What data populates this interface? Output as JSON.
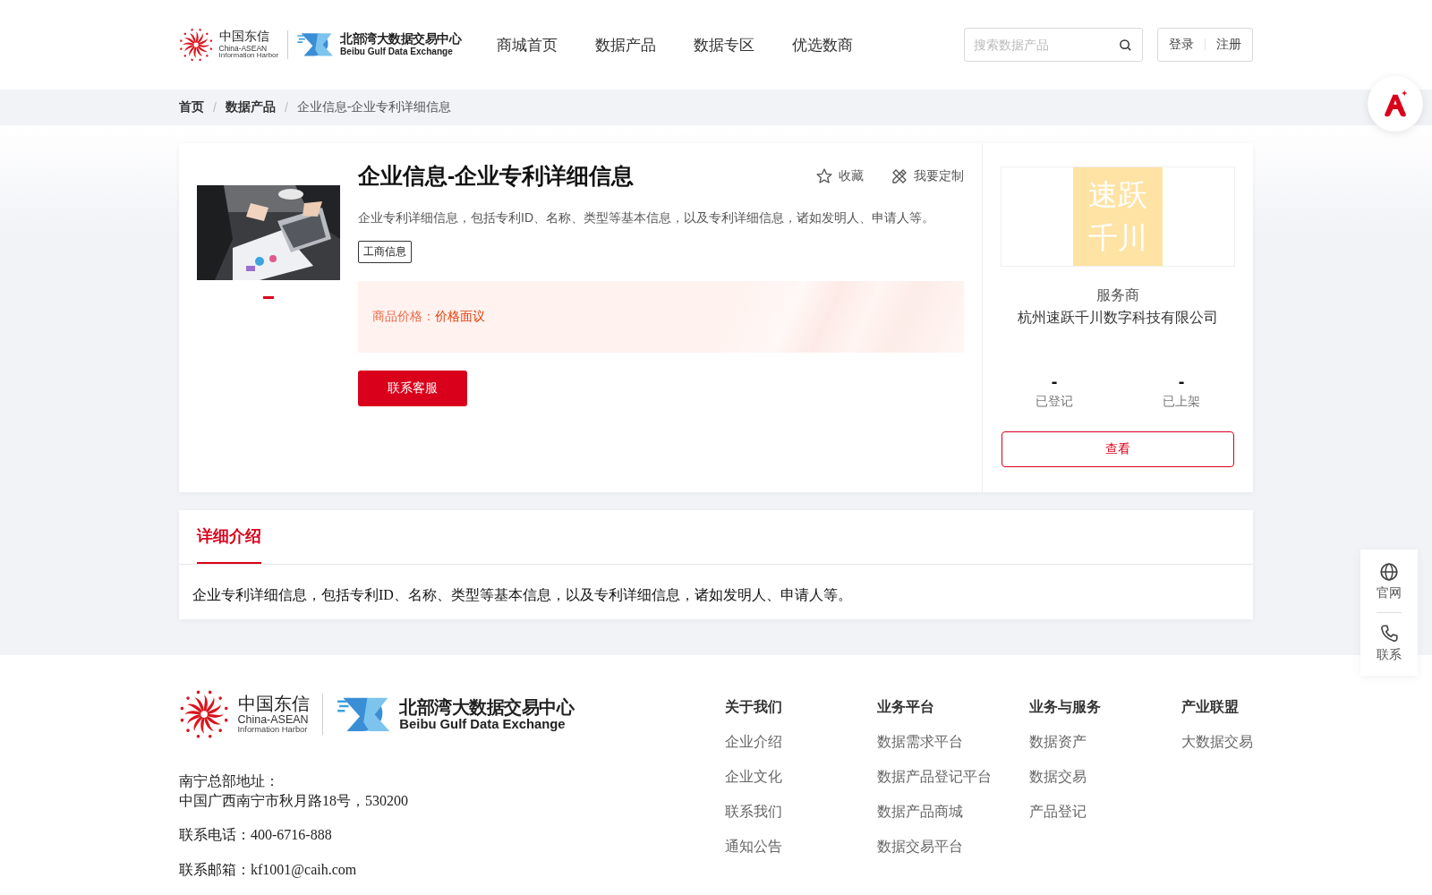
{
  "logo": {
    "cn": "中国东信",
    "en1": "China-ASEAN",
    "en2": "Information Harbor",
    "exchange_cn": "北部湾大数据交易中心",
    "exchange_en": "Beibu Gulf Data Exchange"
  },
  "nav": [
    {
      "label": "商城首页",
      "selected": false
    },
    {
      "label": "数据产品",
      "selected": false
    },
    {
      "label": "数据专区",
      "selected": false
    },
    {
      "label": "优选数商",
      "selected": false
    }
  ],
  "search": {
    "placeholder": "搜索数据产品"
  },
  "auth": [
    "登录",
    "注册"
  ],
  "breadcrumb": [
    "首页",
    "数据产品",
    "企业信息-企业专利详细信息"
  ],
  "breadcrumb_separator": "/",
  "product": {
    "title": "企业信息-企业专利详细信息",
    "actions": [
      "收藏",
      "我要定制"
    ],
    "description": "企业专利详细信息，包括专利ID、名称、类型等基本信息，以及专利详细信息，诸如发明人、申请人等。",
    "tags": [
      "工商信息"
    ],
    "price_label": "商品价格：",
    "price": "价格面议",
    "button": "联系客服",
    "slides": [
      {
        "kind": "picture",
        "selected": true
      }
    ]
  },
  "provider": {
    "logo_lines": [
      "速跃",
      "千川"
    ],
    "role": "服务商",
    "name": "杭州速跃千川数字科技有限公司",
    "stats": [
      {
        "value": "-",
        "label": "已登记"
      },
      {
        "value": "-",
        "label": "已上架"
      }
    ],
    "button": "查看"
  },
  "detail": {
    "tabs": [
      {
        "label": "详细介绍",
        "selected": true
      }
    ],
    "text": "企业专利详细信息，包括专利ID、名称、类型等基本信息，以及专利详细信息，诸如发明人、申请人等。"
  },
  "float_bar": [
    {
      "kind": "globe",
      "label": "官网"
    },
    {
      "kind": "phone",
      "label": "联系"
    }
  ],
  "footer": {
    "logo": {
      "cn": "中国东信",
      "en1": "China-ASEAN",
      "en2": "Information Harbor",
      "exchange_cn": "北部湾大数据交易中心",
      "exchange_en": "Beibu Gulf Data Exchange"
    },
    "address_label": "南宁总部地址：",
    "address": "中国广西南宁市秋月路18号，530200",
    "phone": "联系电话：400-6716-888",
    "email": "联系邮箱：kf1001@caih.com",
    "columns": [
      {
        "title": "关于我们",
        "links": [
          "企业介绍",
          "企业文化",
          "联系我们",
          "通知公告"
        ]
      },
      {
        "title": "业务平台",
        "links": [
          "数据需求平台",
          "数据产品登记平台",
          "数据产品商城",
          "数据交易平台"
        ]
      },
      {
        "title": "业务与服务",
        "links": [
          "数据资产",
          "数据交易",
          "产品登记"
        ]
      },
      {
        "title": "产业联盟",
        "links": [
          "大数据交易"
        ]
      }
    ]
  }
}
